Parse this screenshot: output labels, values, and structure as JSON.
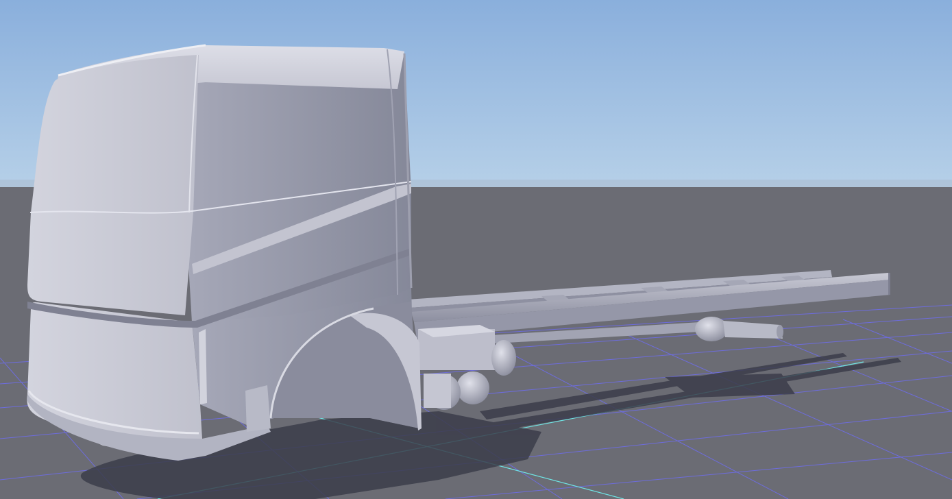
{
  "viewport": {
    "kind": "3d-scene-viewport",
    "sky_top_color": "#8db2de",
    "sky_horizon_color": "#b4cfe8",
    "ground_color": "#6b6c74",
    "grid_color": "#6e6cf0",
    "grid_axis_color": "#6fe6e6",
    "shadow_color": "#3b3d4a",
    "model_color": "#c9cad6",
    "model_shade_color": "#8b8d9d",
    "model_highlight_color": "#e4e5ee"
  },
  "scene_objects": {
    "grid": "ground-grid",
    "model": "truck-cab-and-chassis",
    "shadow": "model-shadow"
  }
}
